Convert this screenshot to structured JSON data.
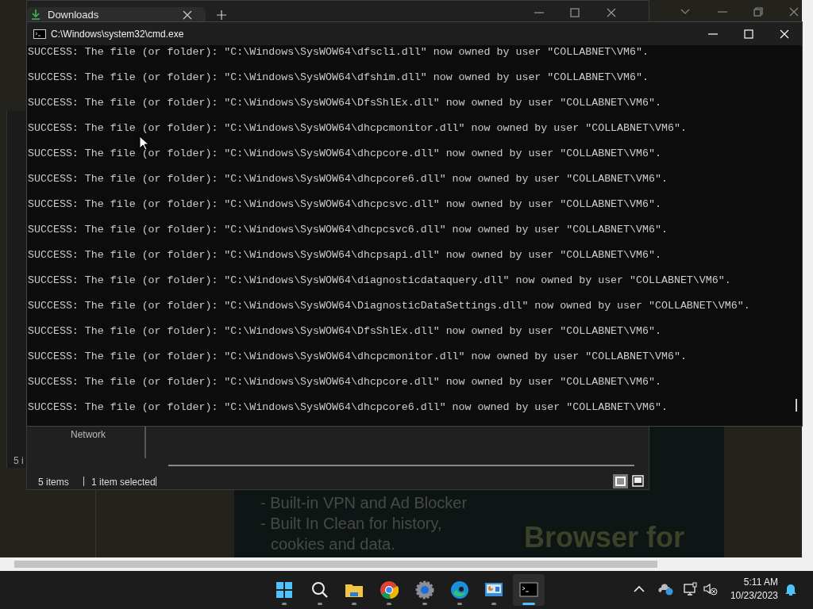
{
  "explorer": {
    "tab_title": "Downloads",
    "nav_item": "Network",
    "status_items": "5 items",
    "status_selection": "1 item selected",
    "back_window_status": "5 i"
  },
  "browser_page": {
    "bullets": [
      "- Built-in VPN and Ad Blocker",
      "- Built In Clean for history,",
      "cookies and data."
    ],
    "banner": "Browser for"
  },
  "cmd": {
    "title": "C:\\Windows\\system32\\cmd.exe",
    "lines": [
      "SUCCESS: The file (or folder): \"C:\\Windows\\SysWOW64\\dfscli.dll\" now owned by user \"COLLABNET\\VM6\".",
      "SUCCESS: The file (or folder): \"C:\\Windows\\SysWOW64\\dfshim.dll\" now owned by user \"COLLABNET\\VM6\".",
      "SUCCESS: The file (or folder): \"C:\\Windows\\SysWOW64\\DfsShlEx.dll\" now owned by user \"COLLABNET\\VM6\".",
      "SUCCESS: The file (or folder): \"C:\\Windows\\SysWOW64\\dhcpcmonitor.dll\" now owned by user \"COLLABNET\\VM6\".",
      "SUCCESS: The file (or folder): \"C:\\Windows\\SysWOW64\\dhcpcore.dll\" now owned by user \"COLLABNET\\VM6\".",
      "SUCCESS: The file (or folder): \"C:\\Windows\\SysWOW64\\dhcpcore6.dll\" now owned by user \"COLLABNET\\VM6\".",
      "SUCCESS: The file (or folder): \"C:\\Windows\\SysWOW64\\dhcpcsvc.dll\" now owned by user \"COLLABNET\\VM6\".",
      "SUCCESS: The file (or folder): \"C:\\Windows\\SysWOW64\\dhcpcsvc6.dll\" now owned by user \"COLLABNET\\VM6\".",
      "SUCCESS: The file (or folder): \"C:\\Windows\\SysWOW64\\dhcpsapi.dll\" now owned by user \"COLLABNET\\VM6\".",
      "SUCCESS: The file (or folder): \"C:\\Windows\\SysWOW64\\diagnosticdataquery.dll\" now owned by user \"COLLABNET\\VM6\".",
      "SUCCESS: The file (or folder): \"C:\\Windows\\SysWOW64\\DiagnosticDataSettings.dll\" now owned by user \"COLLABNET\\VM6\".",
      "SUCCESS: The file (or folder): \"C:\\Windows\\SysWOW64\\DfsShlEx.dll\" now owned by user \"COLLABNET\\VM6\".",
      "SUCCESS: The file (or folder): \"C:\\Windows\\SysWOW64\\dhcpcmonitor.dll\" now owned by user \"COLLABNET\\VM6\".",
      "SUCCESS: The file (or folder): \"C:\\Windows\\SysWOW64\\dhcpcore.dll\" now owned by user \"COLLABNET\\VM6\".",
      "SUCCESS: The file (or folder): \"C:\\Windows\\SysWOW64\\dhcpcore6.dll\" now owned by user \"COLLABNET\\VM6\"."
    ]
  },
  "taskbar": {
    "apps": [
      {
        "kind": "start",
        "active": false
      },
      {
        "kind": "search",
        "active": false
      },
      {
        "kind": "folder",
        "active": false
      },
      {
        "kind": "chrome",
        "active": false
      },
      {
        "kind": "settings",
        "active": false
      },
      {
        "kind": "edge",
        "active": false
      },
      {
        "kind": "control",
        "active": false
      },
      {
        "kind": "terminal",
        "active": true
      }
    ],
    "time": "5:11 AM",
    "date": "10/23/2023"
  }
}
